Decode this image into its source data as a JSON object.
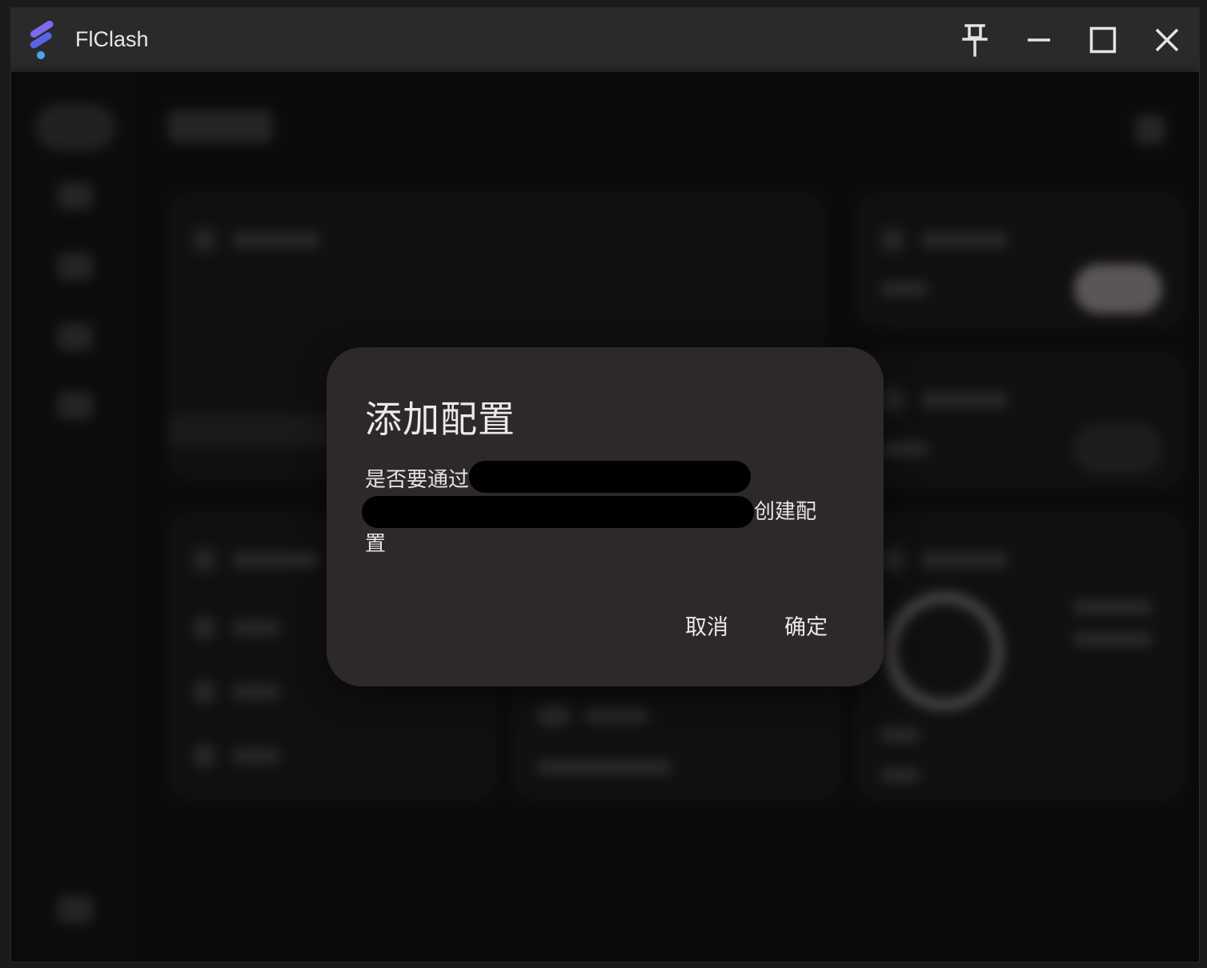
{
  "window": {
    "app_title": "FlClash",
    "controls": {
      "pin_icon": "pin-icon",
      "minimize_icon": "minimize-icon",
      "maximize_icon": "maximize-icon",
      "close_icon": "close-icon"
    }
  },
  "dialog": {
    "title": "添加配置",
    "body_prefix": "是否要通过",
    "body_suffix": "创建配置",
    "redacted_text": "",
    "cancel_label": "取消",
    "confirm_label": "确定"
  },
  "colors": {
    "dialog_bg": "#2c2928",
    "titlebar_bg": "#2b2a2a",
    "window_bg": "#111010",
    "logo_top": "#7b6cf0",
    "logo_mid": "#5a63e8",
    "logo_dot": "#4aa6f0"
  }
}
